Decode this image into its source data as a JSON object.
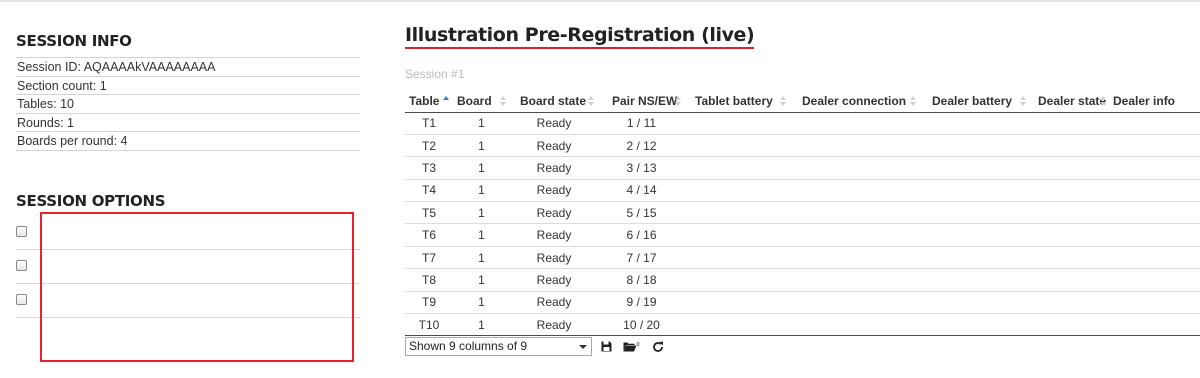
{
  "session_info": {
    "title": "SESSION INFO",
    "rows": [
      "Session ID: AQAAAAkVAAAAAAAA",
      "Section count: 1",
      "Tables: 10",
      "Rounds: 1",
      "Boards per round: 4"
    ]
  },
  "session_options": {
    "title": "SESSION OPTIONS",
    "options": [
      {
        "checked": false
      },
      {
        "checked": false
      },
      {
        "checked": false
      }
    ]
  },
  "main": {
    "title": "Illustration Pre-Registration (live)",
    "session_label": "Session #1",
    "columns": [
      "Table",
      "Board",
      "Board state",
      "Pair NS/EW",
      "Tablet battery",
      "Dealer connection",
      "Dealer battery",
      "Dealer state",
      "Dealer info"
    ],
    "sorted_column": "Table",
    "rows": [
      [
        "T1",
        "1",
        "Ready",
        "1 / 11"
      ],
      [
        "T2",
        "1",
        "Ready",
        "2 / 12"
      ],
      [
        "T3",
        "1",
        "Ready",
        "3 / 13"
      ],
      [
        "T4",
        "1",
        "Ready",
        "4 / 14"
      ],
      [
        "T5",
        "1",
        "Ready",
        "5 / 15"
      ],
      [
        "T6",
        "1",
        "Ready",
        "6 / 16"
      ],
      [
        "T7",
        "1",
        "Ready",
        "7 / 17"
      ],
      [
        "T8",
        "1",
        "Ready",
        "8 / 18"
      ],
      [
        "T9",
        "1",
        "Ready",
        "9 / 19"
      ],
      [
        "T10",
        "1",
        "Ready",
        "10 / 20"
      ]
    ],
    "column_chooser": "Shown 9 columns of 9",
    "icons": [
      "save-icon",
      "folder-open-icon",
      "refresh-icon"
    ],
    "colors": {
      "accent": "#d8232a",
      "highlight": "#e8232f",
      "sort_active": "#2f7fd6"
    }
  }
}
